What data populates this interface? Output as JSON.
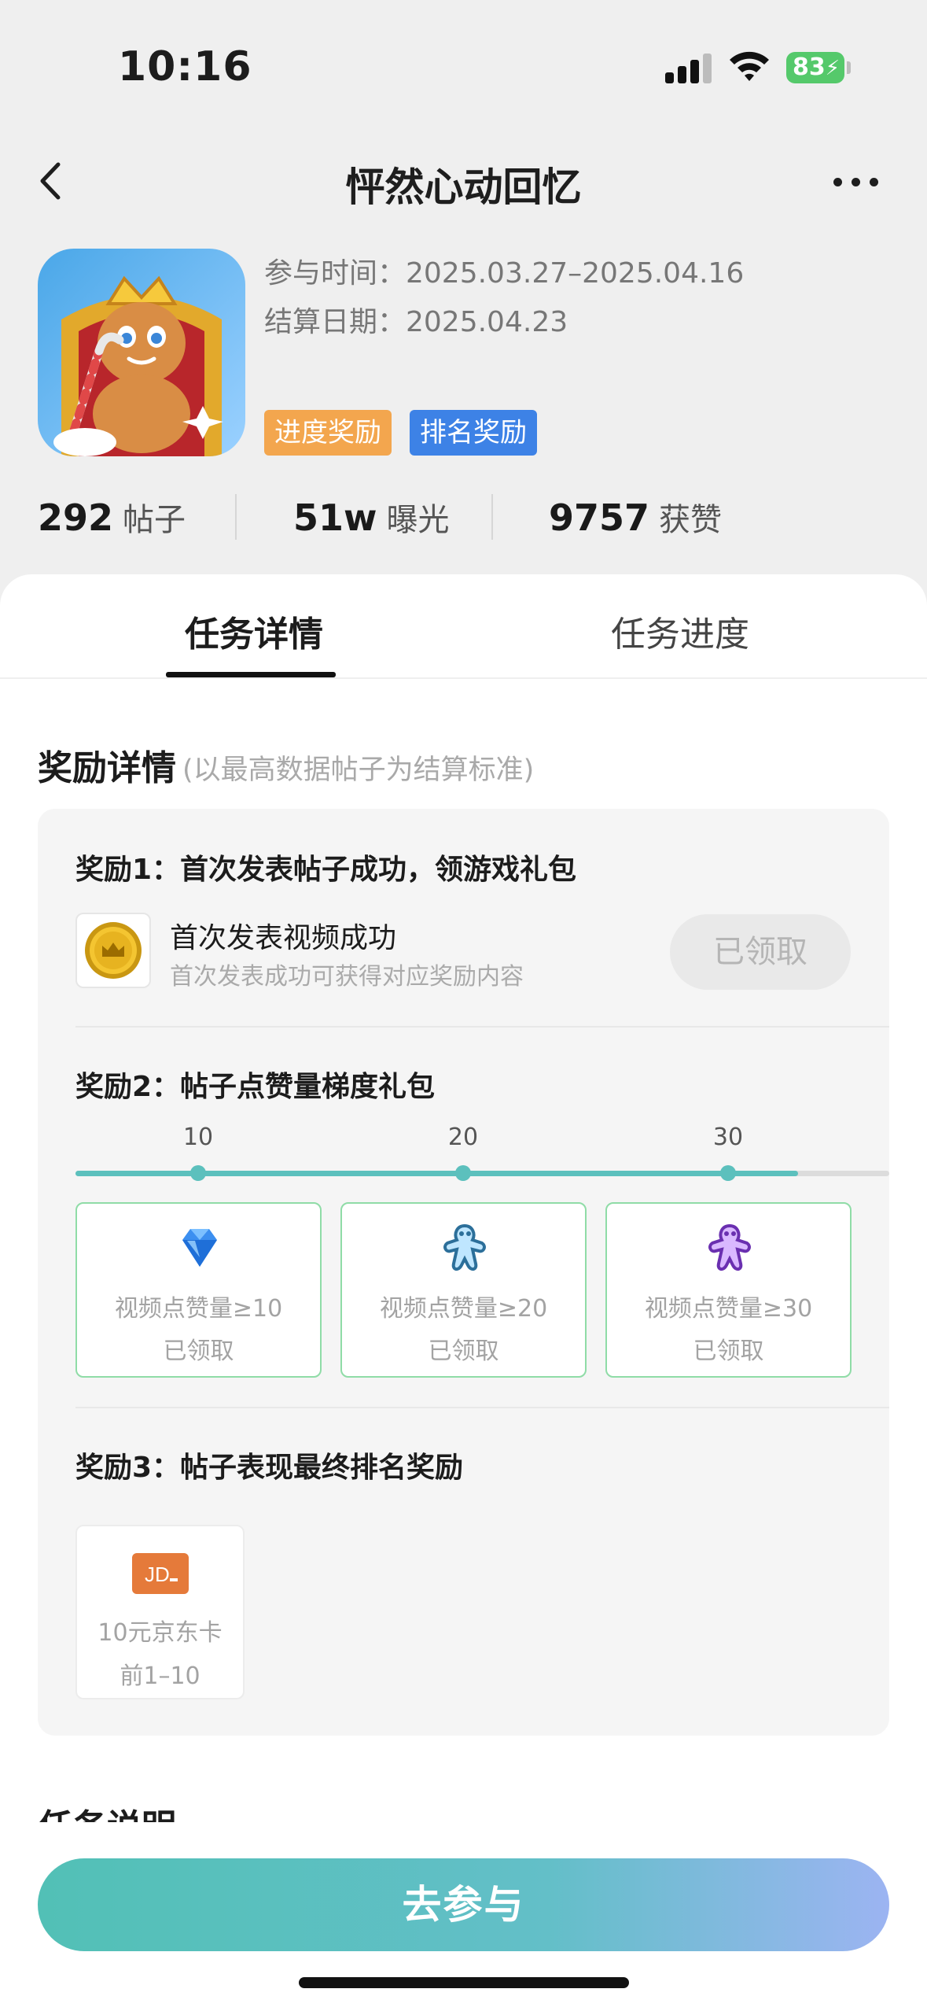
{
  "status_bar": {
    "time": "10:16",
    "battery": "83"
  },
  "nav": {
    "title": "怦然心动回忆"
  },
  "event": {
    "participation_time": "参与时间：2025.03.27–2025.04.16",
    "settlement_date": "结算日期：2025.04.23",
    "tags": [
      {
        "label": "进度奖励",
        "color": "#f3a64e"
      },
      {
        "label": "排名奖励",
        "color": "#3d82e6"
      }
    ]
  },
  "stats": [
    {
      "value": "292",
      "label": "帖子"
    },
    {
      "value": "51w",
      "label": "曝光"
    },
    {
      "value": "9757",
      "label": "获赞"
    }
  ],
  "tabs": [
    {
      "label": "任务详情",
      "active": true
    },
    {
      "label": "任务进度",
      "active": false
    }
  ],
  "reward_section": {
    "title": "奖励详情",
    "note": "(以最高数据帖子为结算标准)",
    "reward1": {
      "heading": "奖励1：首次发表帖子成功，领游戏礼包",
      "item_title": "首次发表视频成功",
      "item_subtitle": "首次发表成功可获得对应奖励内容",
      "button": "已领取",
      "icon": "coin-icon"
    },
    "reward2": {
      "heading": "奖励2：帖子点赞量梯度礼包",
      "progress_fraction": 0.888,
      "tiers": [
        {
          "threshold": "10",
          "condition": "视频点赞量≥10",
          "status": "已领取",
          "icon": "diamond-icon"
        },
        {
          "threshold": "20",
          "condition": "视频点赞量≥20",
          "status": "已领取",
          "icon": "blue-cookie-icon"
        },
        {
          "threshold": "30",
          "condition": "视频点赞量≥30",
          "status": "已领取",
          "icon": "purple-cookie-icon"
        }
      ]
    },
    "reward3": {
      "heading": "奖励3：帖子表现最终排名奖励",
      "item_name": "10元京东卡",
      "rank": "前1–10",
      "icon_text": "JD"
    }
  },
  "next_section_title": "任务说明",
  "cta": {
    "label": "去参与"
  },
  "colors": {
    "accent": "#5cc0bd",
    "card_border": "#8fdca7"
  }
}
